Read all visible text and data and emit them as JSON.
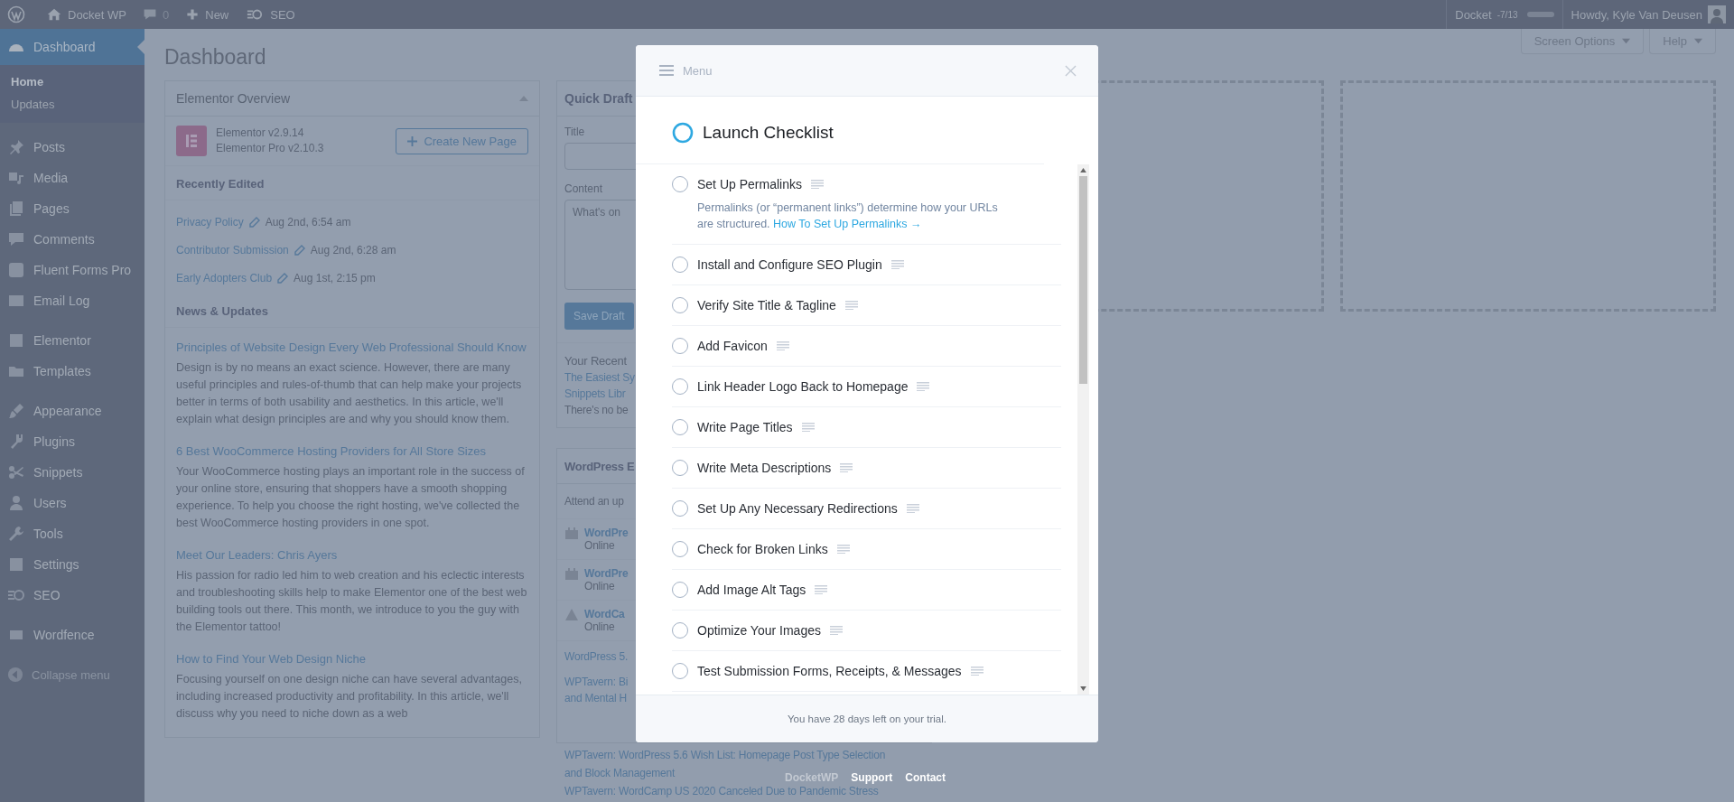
{
  "admin_bar": {
    "site": "Docket WP",
    "comments": "0",
    "new": "New",
    "seo": "SEO",
    "docket": "Docket",
    "docket_count": "-7/13",
    "docket_progress": {
      "level": 0
    },
    "greeting": "Howdy, Kyle Van Deusen"
  },
  "sidebar": {
    "groups": [
      [
        {
          "label": "Dashboard",
          "selected": true,
          "children": [
            {
              "label": "Home",
              "selected": true
            },
            {
              "label": "Updates",
              "selected": false
            }
          ]
        }
      ],
      [
        {
          "label": "Posts",
          "selected": false
        },
        {
          "label": "Media",
          "selected": false
        },
        {
          "label": "Pages",
          "selected": false
        },
        {
          "label": "Comments",
          "selected": false
        },
        {
          "label": "Fluent Forms Pro",
          "selected": false
        },
        {
          "label": "Email Log",
          "selected": false
        }
      ],
      [
        {
          "label": "Elementor",
          "selected": false
        },
        {
          "label": "Templates",
          "selected": false
        }
      ],
      [
        {
          "label": "Appearance",
          "selected": false
        },
        {
          "label": "Plugins",
          "selected": false
        },
        {
          "label": "Snippets",
          "selected": false
        },
        {
          "label": "Users",
          "selected": false
        },
        {
          "label": "Tools",
          "selected": false
        },
        {
          "label": "Settings",
          "selected": false
        },
        {
          "label": "SEO",
          "selected": false
        }
      ],
      [
        {
          "label": "Wordfence",
          "selected": false
        }
      ]
    ],
    "collapse": "Collapse menu"
  },
  "page_title": "Dashboard",
  "screen_options": "Screen Options",
  "help": "Help",
  "elementor_overview": {
    "title": "Elementor Overview",
    "versions": [
      "Elementor v2.9.14",
      "Elementor Pro v2.10.3"
    ],
    "create_button": "Create New Page",
    "recently_edited_title": "Recently Edited",
    "recently_edited": [
      {
        "title": "Privacy Policy",
        "date": "Aug 2nd, 6:54 am"
      },
      {
        "title": "Contributor Submission",
        "date": "Aug 2nd, 6:28 am"
      },
      {
        "title": "Early Adopters Club",
        "date": "Aug 1st, 2:15 pm"
      }
    ],
    "news_title": "News & Updates",
    "news": [
      {
        "title": "Principles of Website Design Every Web Professional Should Know",
        "body": "Design is by no means an exact science. However, there are many useful principles and rules-of-thumb that can help make your projects better in terms of both usability and aesthetics. In this article, we'll explain what design principles are and why you should know them."
      },
      {
        "title": "6 Best WooCommerce Hosting Providers for All Store Sizes",
        "body": "Your WooCommerce hosting plays an important role in the success of your online store, ensuring that shoppers have a smooth shopping experience. To help you choose the right hosting, we've collected the best WooCommerce hosting providers in one spot."
      },
      {
        "title": "Meet Our Leaders: Chris Ayers",
        "body": "His passion for radio led him to web creation and his eclectic interests and troubleshooting skills help to make Elementor one of the best web building tools out there. This month, we introduce to you the guy with the Elementor tattoo!"
      },
      {
        "title": "How to Find Your Web Design Niche",
        "body": "Focusing yourself on one design niche can have several advantages, including increased productivity and profitability. In this article, we'll discuss why you need to niche down as a web"
      }
    ]
  },
  "quick_draft": {
    "title": "Quick Draft",
    "title_label": "Title",
    "content_label": "Content",
    "content_placeholder": "What's on",
    "save": "Save Draft",
    "recent_title": "Your Recent",
    "recent_links": [
      "The Easiest Sy",
      "Snippets Libr"
    ],
    "recent_note": "There's no be"
  },
  "events": {
    "title": "WordPress E",
    "intro": "Attend an up",
    "items": [
      {
        "name": "WordPre",
        "place": "Online",
        "kind": "meetup"
      },
      {
        "name": "WordPre",
        "place": "Online",
        "kind": "meetup"
      },
      {
        "name": "WordCa",
        "place": "Online",
        "kind": "wordcamp"
      }
    ],
    "news": [
      {
        "lines": [
          "WordPress 5."
        ]
      },
      {
        "lines": [
          "WPTavern: Bi",
          "and Mental H"
        ]
      }
    ],
    "news_below": [
      {
        "lines": [
          "WPTavern: WordPress 5.6 Wish List: Homepage Post Type Selection",
          "and Block Management"
        ]
      },
      {
        "lines": [
          "WPTavern: WordCamp US 2020 Canceled Due to Pandemic Stress"
        ]
      }
    ]
  },
  "modal": {
    "menu": "Menu",
    "title": "Launch Checklist",
    "items": [
      {
        "label": "Set Up Permalinks",
        "checked": false,
        "description": "Permalinks (or “permanent links”) determine how your URLs are structured.",
        "link": "How To Set Up Permalinks →"
      },
      {
        "label": "Install and Configure SEO Plugin",
        "checked": false
      },
      {
        "label": "Verify Site Title & Tagline",
        "checked": false
      },
      {
        "label": "Add Favicon",
        "checked": false
      },
      {
        "label": "Link Header Logo Back to Homepage",
        "checked": false
      },
      {
        "label": "Write Page Titles",
        "checked": false
      },
      {
        "label": "Write Meta Descriptions",
        "checked": false
      },
      {
        "label": "Set Up Any Necessary Redirections",
        "checked": false
      },
      {
        "label": "Check for Broken Links",
        "checked": false
      },
      {
        "label": "Add Image Alt Tags",
        "checked": false
      },
      {
        "label": "Optimize Your Images",
        "checked": false
      },
      {
        "label": "Test Submission Forms, Receipts, & Messages",
        "checked": false
      }
    ],
    "footer": "You have 28 days left on your trial."
  },
  "footer_links": [
    {
      "label": "DocketWP",
      "kind": "brand"
    },
    {
      "label": "Support",
      "kind": "link"
    },
    {
      "label": "Contact",
      "kind": "link"
    }
  ]
}
